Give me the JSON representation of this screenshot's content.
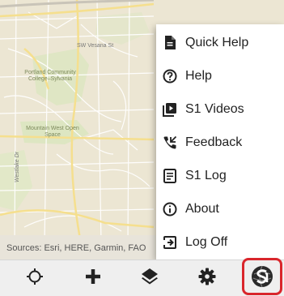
{
  "map": {
    "labels": {
      "street": "SW Vesana St",
      "college": "Portland Community College–Sylvania",
      "openspace": "Mountain West Open Space",
      "westlake": "Westlake Dr"
    },
    "attribution": "Sources: Esri, HERE, Garmin, FAO"
  },
  "menu": {
    "items": [
      {
        "label": "Quick Help",
        "icon": "document-icon"
      },
      {
        "label": "Help",
        "icon": "question-circle-icon"
      },
      {
        "label": "S1 Videos",
        "icon": "video-library-icon"
      },
      {
        "label": "Feedback",
        "icon": "phone-callback-icon"
      },
      {
        "label": "S1 Log",
        "icon": "log-document-icon"
      },
      {
        "label": "About",
        "icon": "info-circle-icon"
      },
      {
        "label": "Log Off",
        "icon": "exit-icon"
      }
    ]
  },
  "toolbar": {
    "buttons": [
      {
        "name": "locate-button",
        "icon": "crosshair-icon"
      },
      {
        "name": "add-button",
        "icon": "plus-icon"
      },
      {
        "name": "layers-button",
        "icon": "layers-icon"
      },
      {
        "name": "settings-button",
        "icon": "gear-icon"
      },
      {
        "name": "app-menu-button",
        "icon": "s1-globe-logo-icon"
      }
    ],
    "highlight_color": "#d9262c"
  }
}
